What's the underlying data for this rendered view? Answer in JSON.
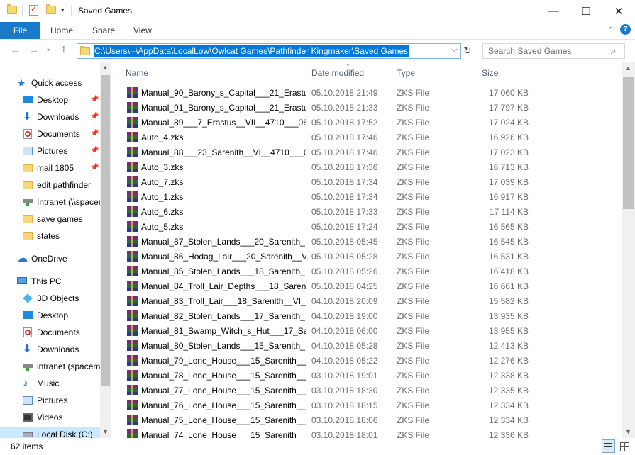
{
  "window": {
    "title": "Saved Games",
    "minimize_glyph": "—",
    "maximize_glyph": "☐",
    "close_glyph": "✕"
  },
  "ribbon": {
    "file": "File",
    "home": "Home",
    "share": "Share",
    "view": "View"
  },
  "address": {
    "path": "C:\\Users\\--\\AppData\\LocalLow\\Owlcat Games\\Pathfinder Kingmaker\\Saved Games"
  },
  "search": {
    "placeholder": "Search Saved Games"
  },
  "nav": {
    "items": [
      {
        "label": "Quick access",
        "icon": "star-icon",
        "pinned": false
      },
      {
        "label": "Desktop",
        "icon": "desktop-icon",
        "pinned": true
      },
      {
        "label": "Downloads",
        "icon": "download-icon",
        "pinned": true
      },
      {
        "label": "Documents",
        "icon": "documents-icon",
        "pinned": true
      },
      {
        "label": "Pictures",
        "icon": "pictures-icon",
        "pinned": true
      },
      {
        "label": "mail 1805",
        "icon": "folder-icon",
        "pinned": true
      },
      {
        "label": "edit pathfinder",
        "icon": "folder-icon",
        "pinned": false
      },
      {
        "label": "Intranet (\\\\spacem",
        "icon": "network-drive-icon",
        "pinned": false
      },
      {
        "label": "save games",
        "icon": "folder-icon",
        "pinned": false
      },
      {
        "label": "states",
        "icon": "folder-icon",
        "pinned": false
      },
      {
        "label": "OneDrive",
        "icon": "cloud-icon",
        "pinned": false
      },
      {
        "label": "This PC",
        "icon": "computer-icon",
        "pinned": false
      },
      {
        "label": "3D Objects",
        "icon": "3d-objects-icon",
        "pinned": false
      },
      {
        "label": "Desktop",
        "icon": "desktop-icon",
        "pinned": false
      },
      {
        "label": "Documents",
        "icon": "documents-icon",
        "pinned": false
      },
      {
        "label": "Downloads",
        "icon": "download-icon",
        "pinned": false
      },
      {
        "label": "intranet (spacem",
        "icon": "network-drive-icon",
        "pinned": false
      },
      {
        "label": "Music",
        "icon": "music-icon",
        "pinned": false
      },
      {
        "label": "Pictures",
        "icon": "pictures-icon",
        "pinned": false
      },
      {
        "label": "Videos",
        "icon": "videos-icon",
        "pinned": false
      },
      {
        "label": "Local Disk (C:)",
        "icon": "disk-icon",
        "pinned": false
      }
    ]
  },
  "columns": {
    "name": "Name",
    "date": "Date modified",
    "type": "Type",
    "size": "Size"
  },
  "files": [
    {
      "name": "Manual_90_Barony_s_Capital___21_Erastu...",
      "date": "05.10.2018 21:49",
      "type": "ZKS File",
      "size": "17 060 KB"
    },
    {
      "name": "Manual_91_Barony_s_Capital___21_Erastu...",
      "date": "05.10.2018 21:33",
      "type": "ZKS File",
      "size": "17 797 KB"
    },
    {
      "name": "Manual_89___7_Erastus__VII__4710___06_...",
      "date": "05.10.2018 17:52",
      "type": "ZKS File",
      "size": "17 024 KB"
    },
    {
      "name": "Auto_4.zks",
      "date": "05.10.2018 17:46",
      "type": "ZKS File",
      "size": "16 926 KB"
    },
    {
      "name": "Manual_88___23_Sarenith__VI__4710___0...",
      "date": "05.10.2018 17:46",
      "type": "ZKS File",
      "size": "17 023 KB"
    },
    {
      "name": "Auto_3.zks",
      "date": "05.10.2018 17:36",
      "type": "ZKS File",
      "size": "16 713 KB"
    },
    {
      "name": "Auto_7.zks",
      "date": "05.10.2018 17:34",
      "type": "ZKS File",
      "size": "17 039 KB"
    },
    {
      "name": "Auto_1.zks",
      "date": "05.10.2018 17:34",
      "type": "ZKS File",
      "size": "16 917 KB"
    },
    {
      "name": "Auto_6.zks",
      "date": "05.10.2018 17:33",
      "type": "ZKS File",
      "size": "17 114 KB"
    },
    {
      "name": "Auto_5.zks",
      "date": "05.10.2018 17:24",
      "type": "ZKS File",
      "size": "16 565 KB"
    },
    {
      "name": "Manual_87_Stolen_Lands___20_Sarenith_...",
      "date": "05.10.2018 05:45",
      "type": "ZKS File",
      "size": "16 545 KB"
    },
    {
      "name": "Manual_86_Hodag_Lair___20_Sarenith__VI...",
      "date": "05.10.2018 05:28",
      "type": "ZKS File",
      "size": "16 531 KB"
    },
    {
      "name": "Manual_85_Stolen_Lands___18_Sarenith_...",
      "date": "05.10.2018 05:26",
      "type": "ZKS File",
      "size": "16 418 KB"
    },
    {
      "name": "Manual_84_Troll_Lair_Depths___18_Sareni...",
      "date": "05.10.2018 04:25",
      "type": "ZKS File",
      "size": "16 661 KB"
    },
    {
      "name": "Manual_83_Troll_Lair___18_Sarenith__VI_...",
      "date": "04.10.2018 20:09",
      "type": "ZKS File",
      "size": "15 582 KB"
    },
    {
      "name": "Manual_82_Stolen_Lands___17_Sarenith_...",
      "date": "04.10.2018 19:00",
      "type": "ZKS File",
      "size": "13 935 KB"
    },
    {
      "name": "Manual_81_Swamp_Witch_s_Hut___17_Sa...",
      "date": "04.10.2018 06:00",
      "type": "ZKS File",
      "size": "13 955 KB"
    },
    {
      "name": "Manual_80_Stolen_Lands___15_Sarenith_...",
      "date": "04.10.2018 05:28",
      "type": "ZKS File",
      "size": "12 413 KB"
    },
    {
      "name": "Manual_79_Lone_House___15_Sarenith__...",
      "date": "04.10.2018 05:22",
      "type": "ZKS File",
      "size": "12 276 KB"
    },
    {
      "name": "Manual_78_Lone_House___15_Sarenith__...",
      "date": "03.10.2018 19:01",
      "type": "ZKS File",
      "size": "12 338 KB"
    },
    {
      "name": "Manual_77_Lone_House___15_Sarenith__...",
      "date": "03.10.2018 18:30",
      "type": "ZKS File",
      "size": "12 335 KB"
    },
    {
      "name": "Manual_76_Lone_House___15_Sarenith__...",
      "date": "03.10.2018 18:15",
      "type": "ZKS File",
      "size": "12 334 KB"
    },
    {
      "name": "Manual_75_Lone_House___15_Sarenith__...",
      "date": "03.10.2018 18:06",
      "type": "ZKS File",
      "size": "12 334 KB"
    },
    {
      "name": "Manual_74_Lone_House___15_Sarenith__...",
      "date": "03.10.2018 18:01",
      "type": "ZKS File",
      "size": "12 336 KB"
    }
  ],
  "status": {
    "count": "62 items"
  },
  "colors": {
    "accent": "#0078d7",
    "file_tab": "#1979ca",
    "header_text": "#4c607a",
    "secondary_text": "#6d6d6d"
  }
}
